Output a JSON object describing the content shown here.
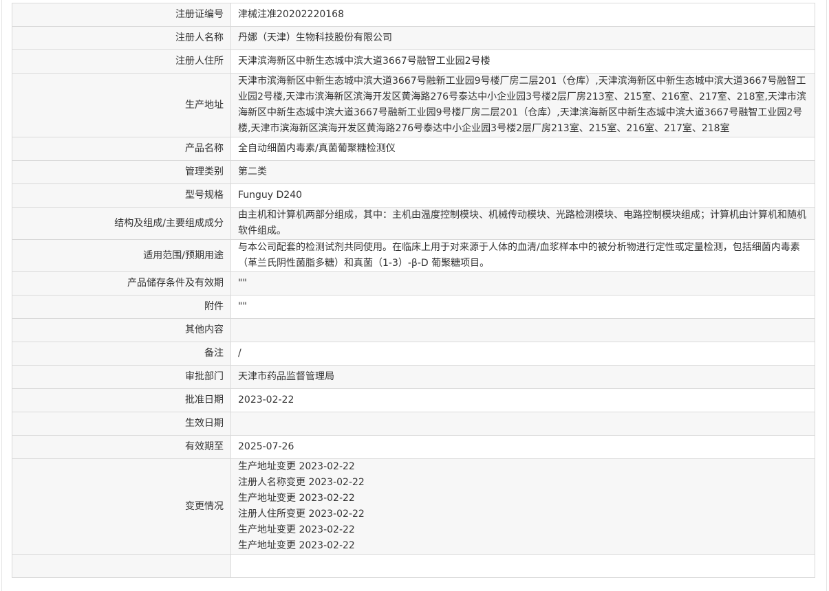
{
  "rows": [
    {
      "label": "注册证编号",
      "value": "津械注准20202220168"
    },
    {
      "label": "注册人名称",
      "value": "丹娜（天津）生物科技股份有限公司"
    },
    {
      "label": "注册人住所",
      "value": "天津滨海新区中新生态城中滨大道3667号融智工业园2号楼"
    },
    {
      "label": "生产地址",
      "value": "天津市滨海新区中新生态城中滨大道3667号融新工业园9号楼厂房二层201（仓库）,天津滨海新区中新生态城中滨大道3667号融智工业园2号楼,天津市滨海新区滨海开发区黄海路276号泰达中小企业园3号楼2层厂房213室、215室、216室、217室、218室,天津市滨海新区中新生态城中滨大道3667号融新工业园9号楼厂房二层201（仓库）,天津滨海新区中新生态城中滨大道3667号融智工业园2号楼,天津市滨海新区滨海开发区黄海路276号泰达中小企业园3号楼2层厂房213室、215室、216室、217室、218室"
    },
    {
      "label": "产品名称",
      "value": "全自动细菌内毒素/真菌葡聚糖检测仪"
    },
    {
      "label": "管理类别",
      "value": "第二类"
    },
    {
      "label": "型号规格",
      "value": "Funguy D240"
    },
    {
      "label": "结构及组成/主要组成成分",
      "value": "由主机和计算机两部分组成，其中：主机由温度控制模块、机械传动模块、光路检测模块、电路控制模块组成；计算机由计算机和随机软件组成。"
    },
    {
      "label": "适用范围/预期用途",
      "value": "与本公司配套的检测试剂共同使用。在临床上用于对来源于人体的血清/血浆样本中的被分析物进行定性或定量检测，包括细菌内毒素（革兰氏阴性菌脂多糖）和真菌（1-3）-β-D 葡聚糖项目。"
    },
    {
      "label": "产品储存条件及有效期",
      "value": "\"\""
    },
    {
      "label": "附件",
      "value": "\"\""
    },
    {
      "label": "其他内容",
      "value": ""
    },
    {
      "label": "备注",
      "value": "/"
    },
    {
      "label": "审批部门",
      "value": "天津市药品监督管理局"
    },
    {
      "label": "批准日期",
      "value": "2023-02-22"
    },
    {
      "label": "生效日期",
      "value": ""
    },
    {
      "label": "有效期至",
      "value": "2025-07-26"
    }
  ],
  "changes": {
    "label": "变更情况",
    "items": [
      "生产地址变更 2023-02-22",
      "注册人名称变更 2023-02-22",
      "生产地址变更 2023-02-22",
      "注册人住所变更 2023-02-22",
      "生产地址变更 2023-02-22",
      "生产地址变更 2023-02-22"
    ]
  }
}
